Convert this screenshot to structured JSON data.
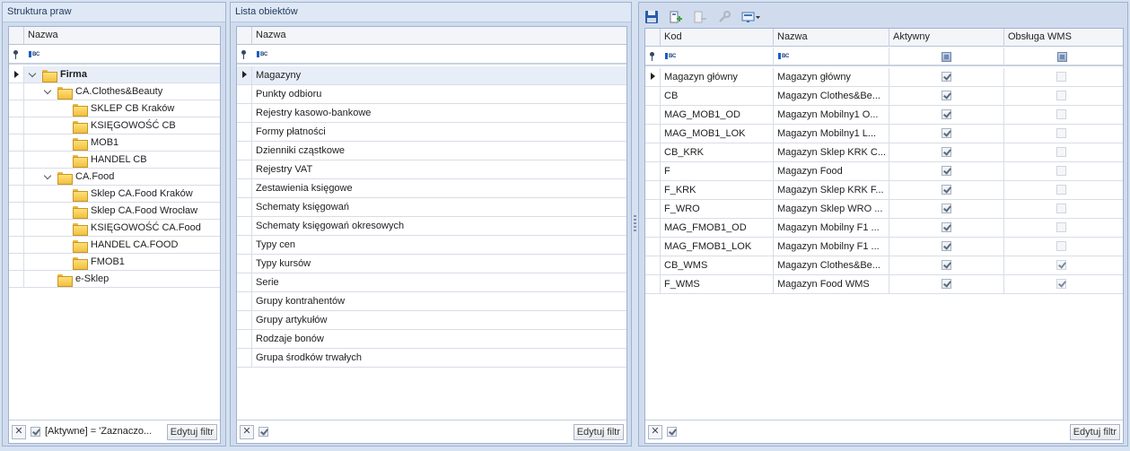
{
  "left_panel": {
    "title": "Struktura praw",
    "column": "Nazwa",
    "tree": [
      {
        "label": "Firma",
        "level": 0,
        "expanded": true,
        "bold": true
      },
      {
        "label": "CA.Clothes&Beauty",
        "level": 1,
        "expanded": true
      },
      {
        "label": "SKLEP CB Kraków",
        "level": 2
      },
      {
        "label": "KSIĘGOWOŚĆ CB",
        "level": 2
      },
      {
        "label": "MOB1",
        "level": 2
      },
      {
        "label": "HANDEL CB",
        "level": 2
      },
      {
        "label": "CA.Food",
        "level": 1,
        "expanded": true
      },
      {
        "label": "Sklep CA.Food Kraków",
        "level": 2
      },
      {
        "label": "Sklep CA.Food Wrocław",
        "level": 2
      },
      {
        "label": "KSIĘGOWOŚĆ CA.Food",
        "level": 2
      },
      {
        "label": "HANDEL CA.FOOD",
        "level": 2
      },
      {
        "label": "FMOB1",
        "level": 2
      },
      {
        "label": "e-Sklep",
        "level": 1
      }
    ],
    "filter_text": "[Aktywne] = 'Zaznaczo...",
    "edit_filter": "Edytuj filtr"
  },
  "middle_panel": {
    "title": "Lista obiektów",
    "column": "Nazwa",
    "items": [
      "Magazyny",
      "Punkty odbioru",
      "Rejestry kasowo-bankowe",
      "Formy płatności",
      "Dzienniki cząstkowe",
      "Rejestry VAT",
      "Zestawienia księgowe",
      "Schematy księgowań",
      "Schematy księgowań okresowych",
      "Typy cen",
      "Typy kursów",
      "Serie",
      "Grupy kontrahentów",
      "Grupy artykułów",
      "Rodzaje bonów",
      "Grupa środków trwałych"
    ],
    "edit_filter": "Edytuj filtr"
  },
  "right_panel": {
    "columns": {
      "kod": "Kod",
      "nazwa": "Nazwa",
      "aktywny": "Aktywny",
      "wms": "Obsługa WMS"
    },
    "rows": [
      {
        "kod": "Magazyn główny",
        "nazwa": "Magazyn główny",
        "aktywny": true,
        "wms": false
      },
      {
        "kod": "CB",
        "nazwa": "Magazyn Clothes&Be...",
        "aktywny": true,
        "wms": false
      },
      {
        "kod": "MAG_MOB1_OD",
        "nazwa": "Magazyn Mobilny1 O...",
        "aktywny": true,
        "wms": false
      },
      {
        "kod": "MAG_MOB1_LOK",
        "nazwa": "Magazyn Mobilny1 L...",
        "aktywny": true,
        "wms": false
      },
      {
        "kod": "CB_KRK",
        "nazwa": "Magazyn Sklep KRK C...",
        "aktywny": true,
        "wms": false
      },
      {
        "kod": "F",
        "nazwa": "Magazyn Food",
        "aktywny": true,
        "wms": false
      },
      {
        "kod": "F_KRK",
        "nazwa": "Magazyn Sklep KRK F...",
        "aktywny": true,
        "wms": false
      },
      {
        "kod": "F_WRO",
        "nazwa": "Magazyn Sklep WRO ...",
        "aktywny": true,
        "wms": false
      },
      {
        "kod": "MAG_FMOB1_OD",
        "nazwa": "Magazyn Mobilny F1 ...",
        "aktywny": true,
        "wms": false
      },
      {
        "kod": "MAG_FMOB1_LOK",
        "nazwa": "Magazyn Mobilny F1 ...",
        "aktywny": true,
        "wms": false
      },
      {
        "kod": "CB_WMS",
        "nazwa": "Magazyn Clothes&Be...",
        "aktywny": true,
        "wms": true
      },
      {
        "kod": "F_WMS",
        "nazwa": "Magazyn Food WMS",
        "aktywny": true,
        "wms": true
      }
    ],
    "edit_filter": "Edytuj filtr"
  },
  "icons": {
    "save": "save-icon",
    "add": "add-object-icon",
    "remove": "remove-object-icon",
    "properties": "wrench-icon",
    "dropdown": "screen-dropdown-icon"
  }
}
